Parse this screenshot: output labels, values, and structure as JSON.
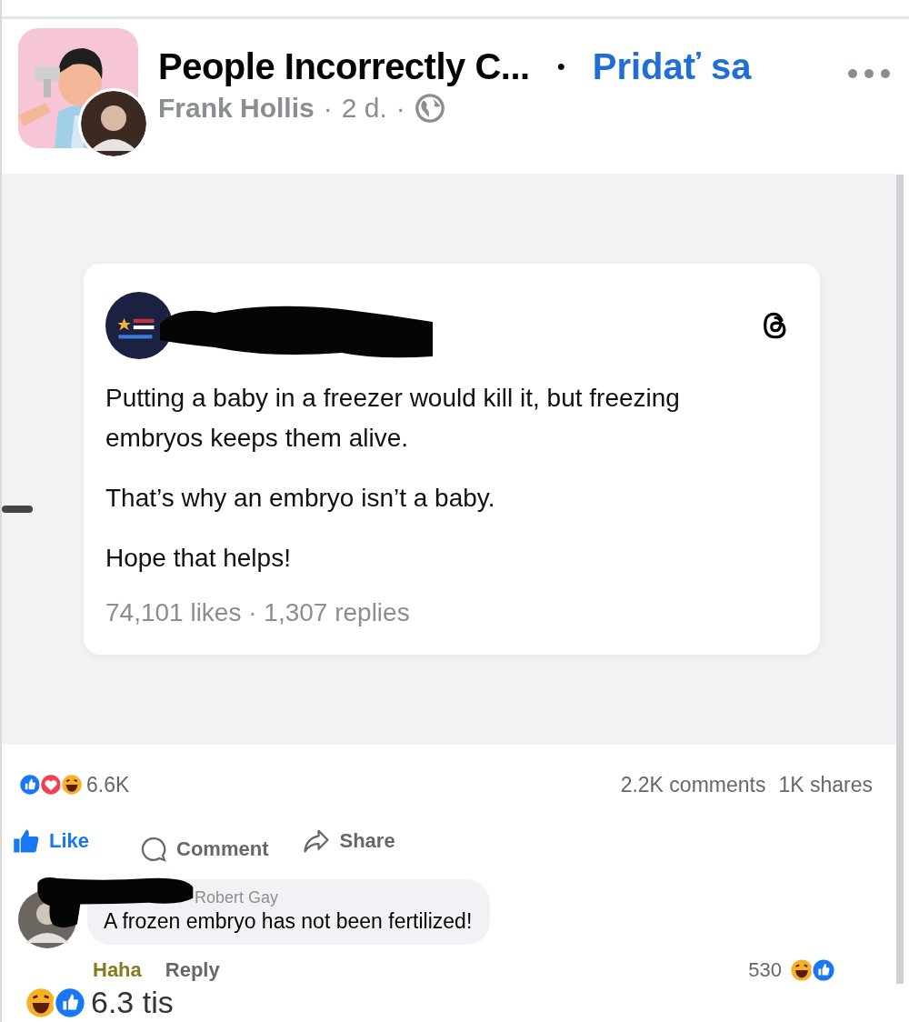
{
  "post": {
    "group_name": "People Incorrectly C...",
    "join_label": "Pridať sa",
    "author": "Frank Hollis",
    "time": "2 d.",
    "separator": "·",
    "join_dot": "•"
  },
  "embedded": {
    "paragraphs": [
      "Putting a baby in a freezer would kill it, but freezing embryos keeps them alive.",
      "That’s why an embryo isn’t a baby.",
      "Hope that helps!"
    ],
    "stats": "74,101 likes · 1,307 replies"
  },
  "reactions": {
    "kinds": [
      {
        "kind": "like"
      },
      {
        "kind": "love"
      },
      {
        "kind": "haha"
      }
    ],
    "count": "6.6K",
    "comments": "2.2K comments",
    "shares": "1K shares"
  },
  "actions": [
    {
      "kind": "like",
      "label": "Like"
    },
    {
      "kind": "comment",
      "label": "Comment"
    },
    {
      "kind": "share",
      "label": "Share"
    }
  ],
  "comment": {
    "name": "Robert Gay",
    "text": "A frozen embryo has not been fertilized!",
    "reaction_label": "Haha",
    "reply_label": "Reply",
    "count": "530",
    "reaction_kinds": [
      {
        "kind": "haha"
      },
      {
        "kind": "like"
      }
    ]
  },
  "next_reactions": {
    "kinds": [
      {
        "kind": "haha"
      },
      {
        "kind": "like"
      }
    ],
    "count": "6.3 tis"
  }
}
